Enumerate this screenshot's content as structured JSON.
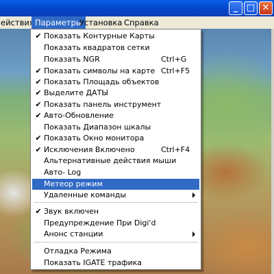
{
  "window": {
    "minimize_label": "_",
    "maximize_label": "□",
    "close_label": "✕"
  },
  "menubar": {
    "items": [
      {
        "label": "ействия"
      },
      {
        "label": "Параметры"
      },
      {
        "label": "Установка"
      },
      {
        "label": "Справка"
      }
    ]
  },
  "menu": {
    "items": [
      {
        "label": "Показать Контурные Карты",
        "checked": true,
        "shortcut": ""
      },
      {
        "label": "Показать квадратов сетки",
        "checked": false,
        "shortcut": ""
      },
      {
        "label": "Показать NGR",
        "checked": false,
        "shortcut": "Ctrl+G"
      },
      {
        "label": "Показать символы на карте",
        "checked": true,
        "shortcut": "Ctrl+F5"
      },
      {
        "label": "Показать Площадь объектов",
        "checked": true,
        "shortcut": ""
      },
      {
        "label": "Выделите ДАТЫ",
        "checked": true,
        "shortcut": ""
      },
      {
        "label": "Показать панель инструмент",
        "checked": true,
        "shortcut": ""
      },
      {
        "label": "Авто-Обновление",
        "checked": true,
        "shortcut": ""
      },
      {
        "label": "Показать  Диапазон шкалы",
        "checked": false,
        "shortcut": ""
      },
      {
        "label": "Показать Окно монитора",
        "checked": true,
        "shortcut": ""
      },
      {
        "label": "Исключения Включено",
        "checked": true,
        "shortcut": "Ctrl+F4"
      },
      {
        "label": "Альтернативные действия мыши",
        "checked": false,
        "shortcut": ""
      },
      {
        "label": "Авто- Log",
        "checked": false,
        "shortcut": ""
      },
      {
        "label": "Метеор режим",
        "checked": false,
        "shortcut": "",
        "highlighted": true
      },
      {
        "label": "Удаленные команды",
        "checked": false,
        "shortcut": "",
        "submenu": true
      },
      {
        "label": "Звук включен",
        "checked": true,
        "shortcut": ""
      },
      {
        "label": "Предупреждение При Digi'd",
        "checked": false,
        "shortcut": ""
      },
      {
        "label": "Анонс станции",
        "checked": false,
        "shortcut": "",
        "submenu": true
      },
      {
        "label": "Отладка Режима",
        "checked": false,
        "shortcut": ""
      },
      {
        "label": "Показать IGATE трафика",
        "checked": false,
        "shortcut": ""
      }
    ],
    "check_glyph": "✔"
  },
  "colors": {
    "highlight": "#316ac5",
    "titlebar": "#0a5fe8",
    "menubar": "#ece9d8"
  },
  "icons": {
    "check": "checkmark-icon",
    "submenu": "submenu-arrow-icon"
  }
}
